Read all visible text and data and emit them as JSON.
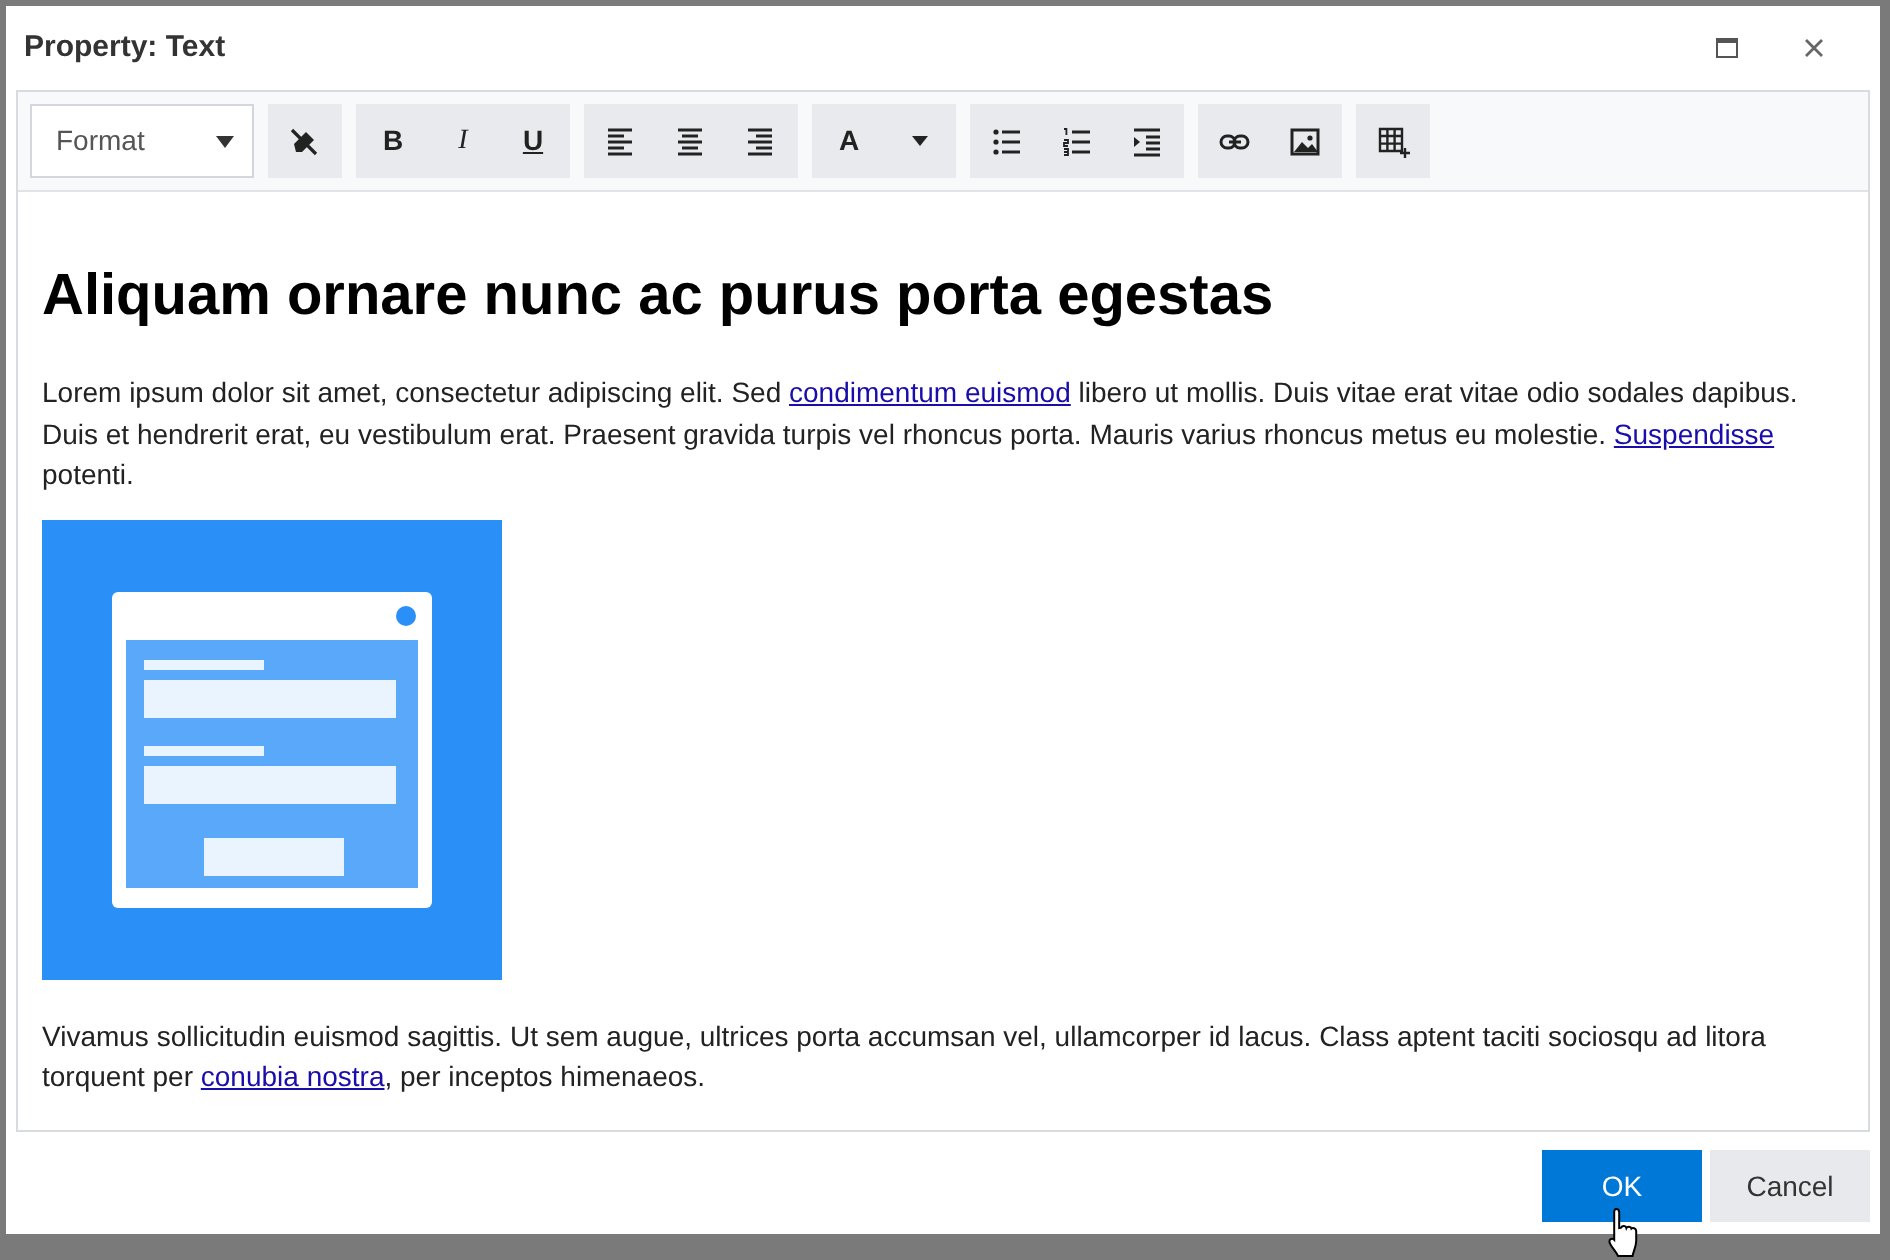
{
  "window": {
    "title": "Property: Text"
  },
  "toolbar": {
    "format_dropdown": {
      "label": "Format"
    },
    "groups": [
      [
        {
          "kind": "clear-format"
        }
      ],
      [
        {
          "kind": "bold",
          "label": "B"
        },
        {
          "kind": "italic",
          "label": "I"
        },
        {
          "kind": "underline",
          "label": "U"
        }
      ],
      [
        {
          "kind": "align-left"
        },
        {
          "kind": "align-center"
        },
        {
          "kind": "align-right"
        }
      ],
      [
        {
          "kind": "font-color",
          "label": "A"
        },
        {
          "kind": "caret"
        }
      ],
      [
        {
          "kind": "bullet-list"
        },
        {
          "kind": "numbered-list"
        },
        {
          "kind": "indent"
        }
      ],
      [
        {
          "kind": "link"
        },
        {
          "kind": "image"
        }
      ],
      [
        {
          "kind": "table"
        }
      ]
    ]
  },
  "content": {
    "heading": "Aliquam ornare nunc ac purus porta egestas",
    "paragraph_1": [
      {
        "kind": "text",
        "text": "Lorem ipsum dolor sit amet, consectetur adipiscing elit. Sed "
      },
      {
        "kind": "link",
        "text": "condimentum euismod"
      },
      {
        "kind": "text",
        "text": " libero ut mollis. Duis vitae erat vitae odio sodales dapibus. Duis et hendrerit erat, eu vestibulum erat. Praesent gravida turpis vel rhoncus porta. Mauris varius rhoncus metus eu molestie. "
      },
      {
        "kind": "link",
        "text": "Suspendisse"
      },
      {
        "kind": "text",
        "text": " potenti."
      }
    ],
    "paragraph_2": [
      {
        "kind": "text",
        "text": "Vivamus sollicitudin euismod sagittis. Ut sem augue, ultrices porta accumsan vel, ullamcorper id lacus. Class aptent taciti sociosqu ad litora torquent per "
      },
      {
        "kind": "link",
        "text": "conubia nostra"
      },
      {
        "kind": "text",
        "text": ", per inceptos himenaeos."
      }
    ]
  },
  "buttons": [
    {
      "label": "OK",
      "kind": "primary"
    },
    {
      "label": "Cancel",
      "kind": "secondary"
    }
  ]
}
